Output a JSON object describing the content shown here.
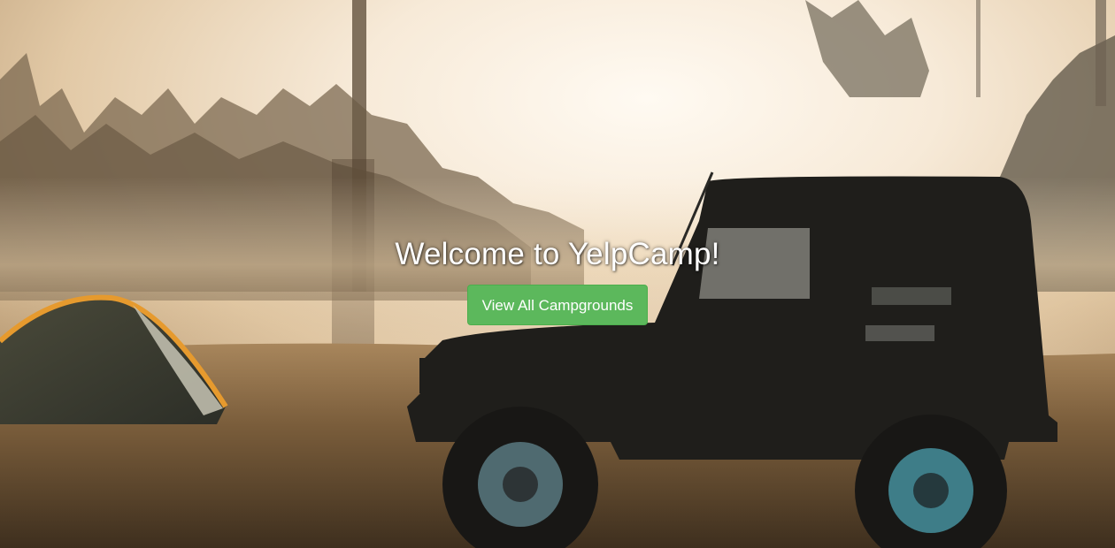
{
  "landing": {
    "title": "Welcome to YelpCamp!",
    "cta_label": "View All Campgrounds"
  },
  "colors": {
    "cta_background": "#5cb85c",
    "title_text": "#ffffff"
  }
}
